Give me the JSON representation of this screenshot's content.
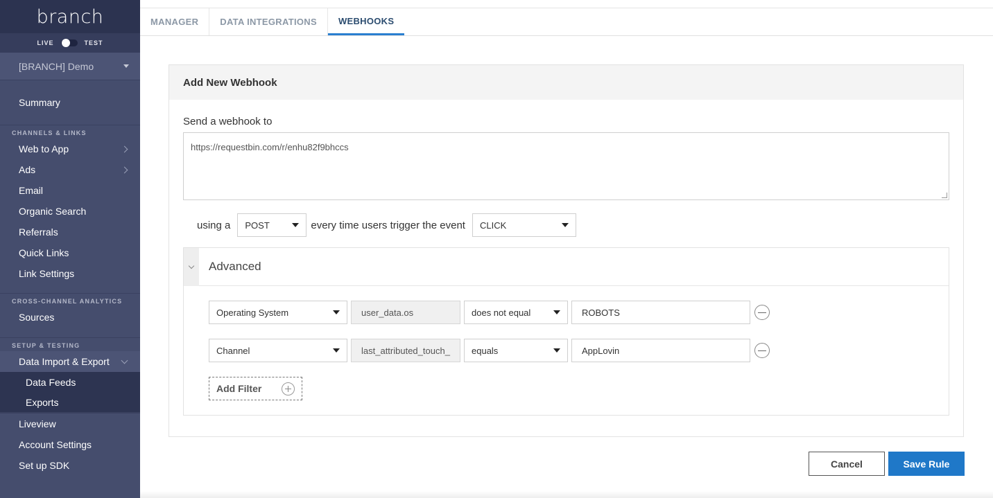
{
  "sidebar": {
    "logo": "branch",
    "env": {
      "live": "LIVE",
      "test": "TEST"
    },
    "account": "[BRANCH] Demo",
    "top_items": [
      {
        "label": "Summary"
      }
    ],
    "sections": [
      {
        "header": "CHANNELS & LINKS",
        "items": [
          {
            "label": "Web to App"
          },
          {
            "label": "Ads"
          },
          {
            "label": "Email"
          },
          {
            "label": "Organic Search"
          },
          {
            "label": "Referrals"
          },
          {
            "label": "Quick Links"
          },
          {
            "label": "Link Settings"
          }
        ]
      },
      {
        "header": "CROSS-CHANNEL ANALYTICS",
        "items": [
          {
            "label": "Sources"
          }
        ]
      },
      {
        "header": "SETUP & TESTING",
        "items": [
          {
            "label": "Data Import & Export"
          },
          {
            "label": "Data Feeds"
          },
          {
            "label": "Exports"
          },
          {
            "label": "Liveview"
          },
          {
            "label": "Account Settings"
          },
          {
            "label": "Set up SDK"
          }
        ]
      }
    ]
  },
  "tabs": [
    {
      "label": "MANAGER"
    },
    {
      "label": "DATA INTEGRATIONS"
    },
    {
      "label": "WEBHOOKS"
    }
  ],
  "card": {
    "title": "Add New Webhook",
    "send_label": "Send a webhook to",
    "url_value": "https://requestbin.com/r/enhu82f9bhccs",
    "using_label": "using a",
    "method": "POST",
    "event_label": "every time users trigger the event",
    "event": "CLICK",
    "advanced": {
      "title": "Advanced",
      "filters": [
        {
          "field": "Operating System",
          "key": "user_data.os",
          "operator": "does not equal",
          "value": "ROBOTS"
        },
        {
          "field": "Channel",
          "key": "last_attributed_touch_",
          "operator": "equals",
          "value": "AppLovin"
        }
      ],
      "add_filter": "Add Filter"
    }
  },
  "actions": {
    "cancel": "Cancel",
    "save": "Save Rule"
  },
  "colors": {
    "sidebar": "#454d6d",
    "accent": "#1f78c8",
    "active_tab": "#2a7fd0"
  }
}
